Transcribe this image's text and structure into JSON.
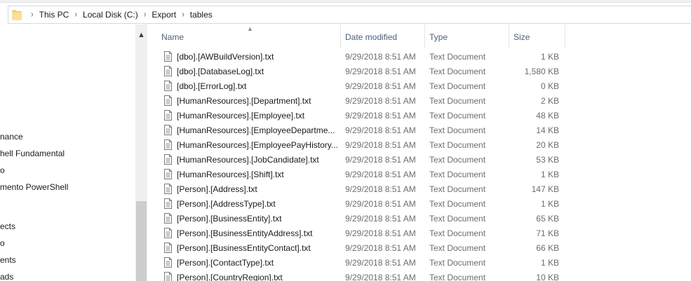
{
  "address": {
    "crumbs": [
      "This PC",
      "Local Disk (C:)",
      "Export",
      "tables"
    ]
  },
  "nav": {
    "items": [
      "nance",
      "hell Fundamental",
      "o",
      "mento PowerShell",
      "ects",
      "o",
      "ents",
      "ads"
    ]
  },
  "columns": {
    "name": "Name",
    "date": "Date modified",
    "type": "Type",
    "size": "Size"
  },
  "files": [
    {
      "name": "[dbo].[AWBuildVersion].txt",
      "date": "9/29/2018 8:51 AM",
      "type": "Text Document",
      "size": "1 KB"
    },
    {
      "name": "[dbo].[DatabaseLog].txt",
      "date": "9/29/2018 8:51 AM",
      "type": "Text Document",
      "size": "1,580 KB"
    },
    {
      "name": "[dbo].[ErrorLog].txt",
      "date": "9/29/2018 8:51 AM",
      "type": "Text Document",
      "size": "0 KB"
    },
    {
      "name": "[HumanResources].[Department].txt",
      "date": "9/29/2018 8:51 AM",
      "type": "Text Document",
      "size": "2 KB"
    },
    {
      "name": "[HumanResources].[Employee].txt",
      "date": "9/29/2018 8:51 AM",
      "type": "Text Document",
      "size": "48 KB"
    },
    {
      "name": "[HumanResources].[EmployeeDepartme...",
      "date": "9/29/2018 8:51 AM",
      "type": "Text Document",
      "size": "14 KB"
    },
    {
      "name": "[HumanResources].[EmployeePayHistory...",
      "date": "9/29/2018 8:51 AM",
      "type": "Text Document",
      "size": "20 KB"
    },
    {
      "name": "[HumanResources].[JobCandidate].txt",
      "date": "9/29/2018 8:51 AM",
      "type": "Text Document",
      "size": "53 KB"
    },
    {
      "name": "[HumanResources].[Shift].txt",
      "date": "9/29/2018 8:51 AM",
      "type": "Text Document",
      "size": "1 KB"
    },
    {
      "name": "[Person].[Address].txt",
      "date": "9/29/2018 8:51 AM",
      "type": "Text Document",
      "size": "147 KB"
    },
    {
      "name": "[Person].[AddressType].txt",
      "date": "9/29/2018 8:51 AM",
      "type": "Text Document",
      "size": "1 KB"
    },
    {
      "name": "[Person].[BusinessEntity].txt",
      "date": "9/29/2018 8:51 AM",
      "type": "Text Document",
      "size": "65 KB"
    },
    {
      "name": "[Person].[BusinessEntityAddress].txt",
      "date": "9/29/2018 8:51 AM",
      "type": "Text Document",
      "size": "71 KB"
    },
    {
      "name": "[Person].[BusinessEntityContact].txt",
      "date": "9/29/2018 8:51 AM",
      "type": "Text Document",
      "size": "66 KB"
    },
    {
      "name": "[Person].[ContactType].txt",
      "date": "9/29/2018 8:51 AM",
      "type": "Text Document",
      "size": "1 KB"
    },
    {
      "name": "[Person].[CountryRegion].txt",
      "date": "9/29/2018 8:51 AM",
      "type": "Text Document",
      "size": "10 KB"
    }
  ],
  "icons": {
    "folder": "folder-icon",
    "file": "text-file-icon",
    "breadcrumb_separator": "chevron-right-icon",
    "sort": "sort-ascending-icon"
  },
  "colors": {
    "header_text": "#4c607a",
    "secondary_text": "#6d6d6d",
    "folder_yellow": "#f8d775"
  }
}
